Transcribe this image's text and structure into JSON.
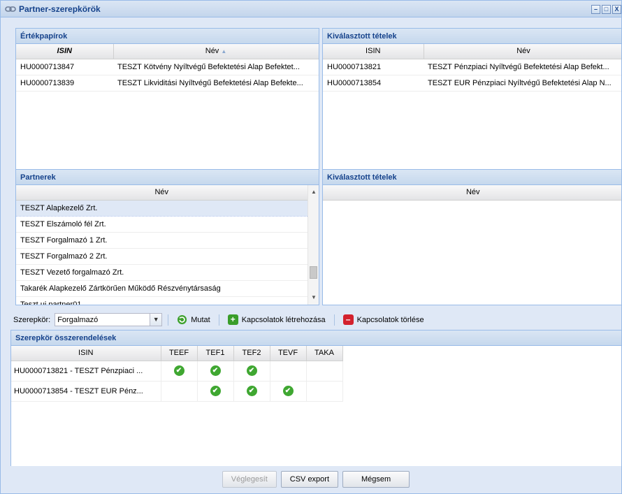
{
  "window": {
    "title": "Partner-szerepkörök",
    "tools": [
      "–",
      "□",
      "X"
    ]
  },
  "securities": {
    "title": "Értékpapírok",
    "columns": [
      "ISIN",
      "Név"
    ],
    "rows": [
      {
        "isin": "HU0000713847",
        "name": "TESZT Kötvény Nyíltvégű Befektetési Alap Befektet..."
      },
      {
        "isin": "HU0000713839",
        "name": "TESZT Likviditási Nyíltvégű Befektetési Alap Befekte..."
      }
    ]
  },
  "selected_securities": {
    "title": "Kiválasztott tételek",
    "columns": [
      "ISIN",
      "Név"
    ],
    "rows": [
      {
        "isin": "HU0000713821",
        "name": "TESZT Pénzpiaci Nyíltvégű Befektetési Alap Befekt..."
      },
      {
        "isin": "HU0000713854",
        "name": "TESZT EUR Pénzpiaci Nyíltvégű Befektetési Alap N..."
      }
    ]
  },
  "partners": {
    "title": "Partnerek",
    "column": "Név",
    "rows": [
      "TESZT Alapkezelő Zrt.",
      "TESZT Elszámoló fél Zrt.",
      "TESZT Forgalmazó 1 Zrt.",
      "TESZT Forgalmazó 2 Zrt.",
      "TESZT Vezető forgalmazó Zrt.",
      "Takarék Alapkezelő Zártkörűen Működő Részvénytársaság",
      "Teszt uj partner01"
    ]
  },
  "selected_partners": {
    "title": "Kiválasztott tételek",
    "column": "Név"
  },
  "toolbar": {
    "role_label": "Szerepkör:",
    "role_value": "Forgalmazó",
    "show_label": "Mutat",
    "create_label": "Kapcsolatok létrehozása",
    "delete_label": "Kapcsolatok törlése"
  },
  "assignments": {
    "title": "Szerepkör összerendelések",
    "columns": [
      "ISIN",
      "TEEF",
      "TEF1",
      "TEF2",
      "TEVF",
      "TAKA"
    ],
    "rows": [
      {
        "isin": "HU0000713821 - TESZT Pénzpiaci ...",
        "marks": [
          true,
          true,
          true,
          false,
          false
        ]
      },
      {
        "isin": "HU0000713854 - TESZT EUR Pénz...",
        "marks": [
          false,
          true,
          true,
          true,
          false
        ]
      }
    ]
  },
  "footer": {
    "finalize_label": "Véglegesít",
    "csv_label": "CSV export",
    "cancel_label": "Mégsem"
  },
  "colors": {
    "header_text": "#15428b",
    "border": "#99bbe8",
    "check": "#3fa731",
    "add": "#3a9d2a",
    "delete": "#d3212d"
  }
}
